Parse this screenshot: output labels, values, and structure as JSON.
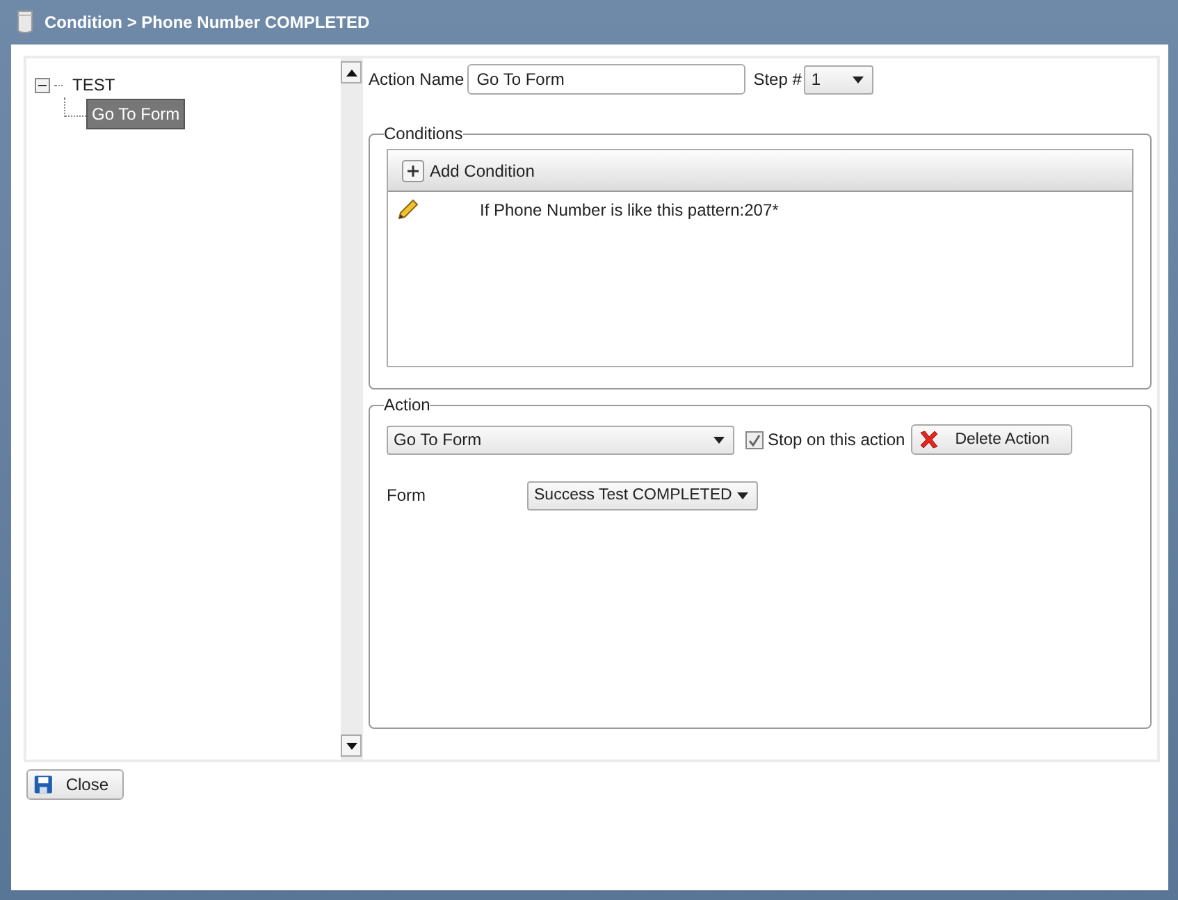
{
  "window": {
    "title": "Condition > Phone Number COMPLETED"
  },
  "tree": [
    {
      "label": "TEST",
      "expanded": true,
      "selected": false,
      "children": [
        {
          "label": "Go To Form",
          "selected": true
        }
      ]
    }
  ],
  "action_name": {
    "label": "Action Name",
    "value": "Go To Form"
  },
  "step": {
    "label": "Step #",
    "value": "1"
  },
  "conditions": {
    "legend": "Conditions",
    "add_button": "Add Condition",
    "rows": [
      {
        "text": "If Phone Number is like this pattern:207*"
      }
    ]
  },
  "action": {
    "legend": "Action",
    "type": "Go To Form",
    "stop": {
      "label": "Stop on this action",
      "checked": true
    },
    "delete_button": "Delete Action",
    "form": {
      "label": "Form",
      "value": "Success Test COMPLETED"
    }
  },
  "close_button": "Close"
}
